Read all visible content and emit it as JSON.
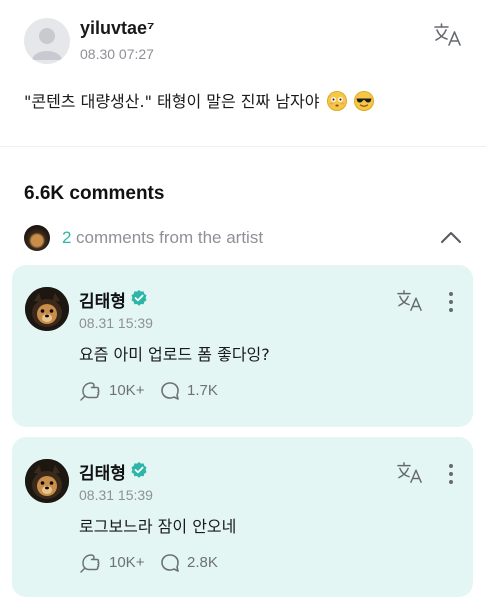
{
  "post": {
    "author": "yiluvtae⁷",
    "timestamp": "08.30 07:27",
    "text": "\"콘텐츠 대량생산.\" 태형이 말은 진짜 남자야",
    "emojis": [
      "flushed-face",
      "smiling-face-with-sunglasses"
    ]
  },
  "comments_section": {
    "count_label": "6.6K comments",
    "artist_count": "2",
    "artist_label": "comments from the artist"
  },
  "comments": [
    {
      "author": "김태형",
      "timestamp": "08.31 15:39",
      "text": "요즘 아미 업로드 폼 좋다잉?",
      "likes": "10K+",
      "replies": "1.7K"
    },
    {
      "author": "김태형",
      "timestamp": "08.31 15:39",
      "text": "로그보느라 잠이 안오네",
      "likes": "10K+",
      "replies": "2.8K"
    }
  ],
  "colors": {
    "accent": "#2bb6a7",
    "card_background": "#e4f6f4",
    "muted_text": "#8d9096"
  },
  "icons": [
    "translate-icon",
    "verified-badge-icon",
    "more-options-icon",
    "like-icon",
    "reply-icon",
    "chevron-up-icon"
  ]
}
